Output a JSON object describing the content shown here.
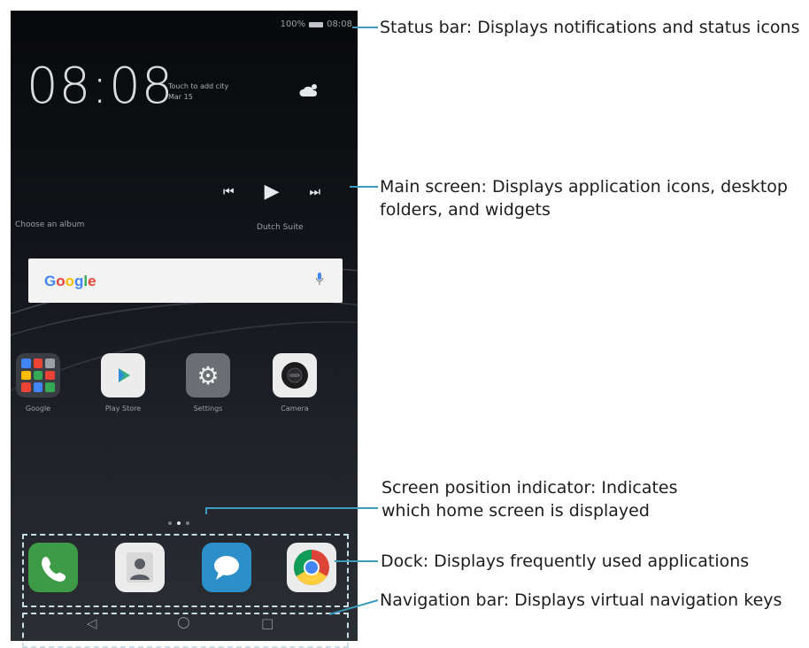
{
  "status_bar": {
    "battery_text": "100%",
    "time": "08:08"
  },
  "clock_widget": {
    "time": "08:08",
    "prompt": "Touch to add city",
    "date": "Mar 15"
  },
  "music_widget": {
    "album_prompt": "Choose an album",
    "artist": "Dutch Suite"
  },
  "search_widget": {
    "brand": "Google"
  },
  "apps": [
    {
      "label": "Google",
      "icon": "google-folder-icon"
    },
    {
      "label": "Play Store",
      "icon": "play-store-icon"
    },
    {
      "label": "Settings",
      "icon": "settings-icon"
    },
    {
      "label": "Camera",
      "icon": "camera-icon"
    }
  ],
  "dock": [
    {
      "icon": "phone-icon"
    },
    {
      "icon": "contacts-icon"
    },
    {
      "icon": "messages-icon"
    },
    {
      "icon": "chrome-icon"
    }
  ],
  "navigation": {
    "back": "◁",
    "home": "○",
    "recent": "□"
  },
  "callouts": {
    "status_bar": "Status bar: Displays notifications and status icons",
    "main_screen": "Main screen: Displays application icons, desktop folders, and widgets",
    "indicator": "Screen position indicator: Indicates which home screen is displayed",
    "dock": "Dock: Displays frequently used applications",
    "navigation": "Navigation bar: Displays virtual navigation keys"
  },
  "colors": {
    "callout_line": "#3d9bbd",
    "dash": "#c8dde6",
    "phone_green": "#3d9a46",
    "messages_blue": "#2d8fc9",
    "chrome_red": "#dc4437"
  }
}
